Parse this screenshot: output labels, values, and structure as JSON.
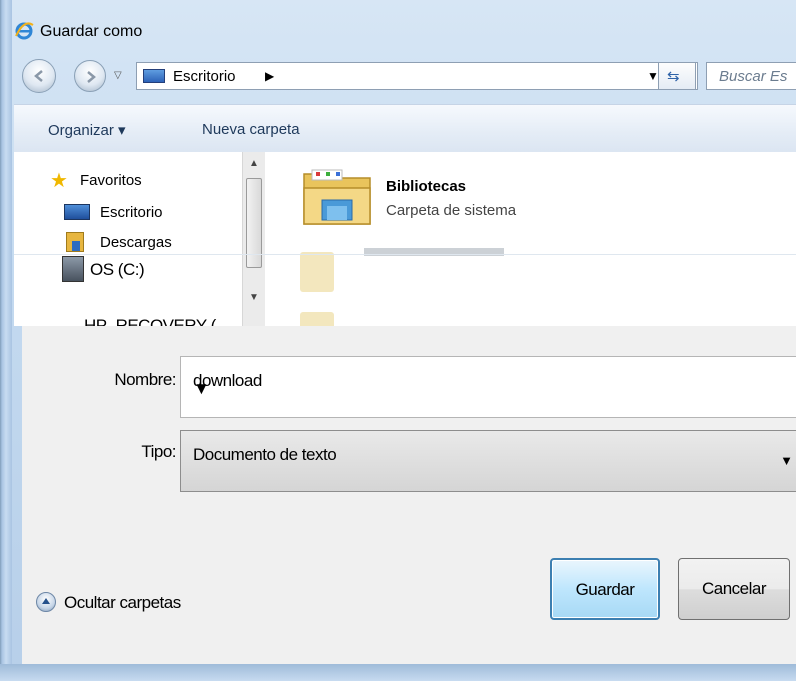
{
  "window": {
    "title": "Guardar como"
  },
  "address": {
    "location": "Escritorio",
    "search_placeholder": "Buscar Es"
  },
  "toolbar": {
    "organize_label": "Organizar ▾",
    "new_folder_label": "Nueva carpeta"
  },
  "nav_pane": {
    "items": [
      {
        "label": "Favoritos",
        "icon": "star-icon"
      },
      {
        "label": "Escritorio",
        "icon": "desktop-icon"
      },
      {
        "label": "Descargas",
        "icon": "downloads-icon"
      },
      {
        "label": "OS (C:)",
        "icon": "drive-icon"
      },
      {
        "label": "HP_RECOVERY (",
        "icon": "drive-icon"
      }
    ]
  },
  "content": {
    "items": [
      {
        "name": "Bibliotecas",
        "description": "Carpeta de sistema",
        "icon": "libraries-folder-icon"
      }
    ]
  },
  "form": {
    "name_label": "Nombre:",
    "name_value": "download",
    "type_label": "Tipo:",
    "type_value": "Documento de texto"
  },
  "footer": {
    "hide_folders_label": "Ocultar carpetas",
    "save_label": "Guardar",
    "cancel_label": "Cancelar"
  },
  "colors": {
    "frame": "#c4daf0",
    "accent_button": "#bee6fd",
    "form_background": "#f0f0f0"
  }
}
